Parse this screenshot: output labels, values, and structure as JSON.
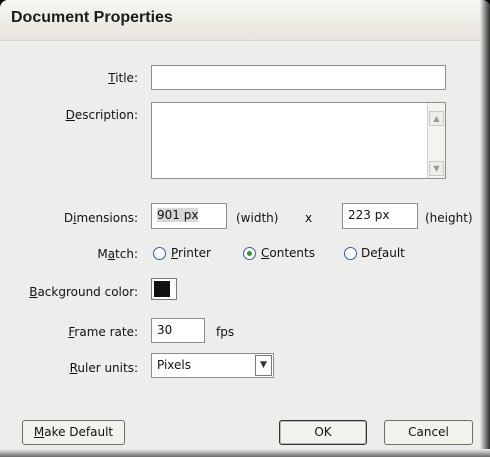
{
  "window": {
    "title": "Document Properties"
  },
  "fields": {
    "title": {
      "label_u": "T",
      "label_rest": "itle:",
      "value": ""
    },
    "description": {
      "label_u": "D",
      "label_rest": "escription:",
      "value": ""
    },
    "dimensions": {
      "label_pre": "D",
      "label_u": "i",
      "label_rest": "mensions:",
      "width_value": "901 px",
      "width_label": "(width)",
      "times": "x",
      "height_value": "223 px",
      "height_label": "(height)"
    },
    "match": {
      "label_pre": "M",
      "label_u": "a",
      "label_rest": "tch:",
      "options": [
        {
          "u": "P",
          "rest": "rinter",
          "selected": false
        },
        {
          "u": "C",
          "rest": "ontents",
          "selected": true
        },
        {
          "pre": "De",
          "u": "f",
          "rest": "ault",
          "selected": false
        }
      ]
    },
    "background": {
      "label_u": "B",
      "label_rest": "ackground color:",
      "color": "#111111"
    },
    "frame_rate": {
      "label_u": "F",
      "label_rest": "rame rate:",
      "value": "30",
      "unit": "fps"
    },
    "ruler_units": {
      "label_u": "R",
      "label_rest": "uler units:",
      "value": "Pixels"
    }
  },
  "buttons": {
    "make_default": {
      "u": "M",
      "rest": "ake Default"
    },
    "ok": "OK",
    "cancel": "Cancel"
  }
}
